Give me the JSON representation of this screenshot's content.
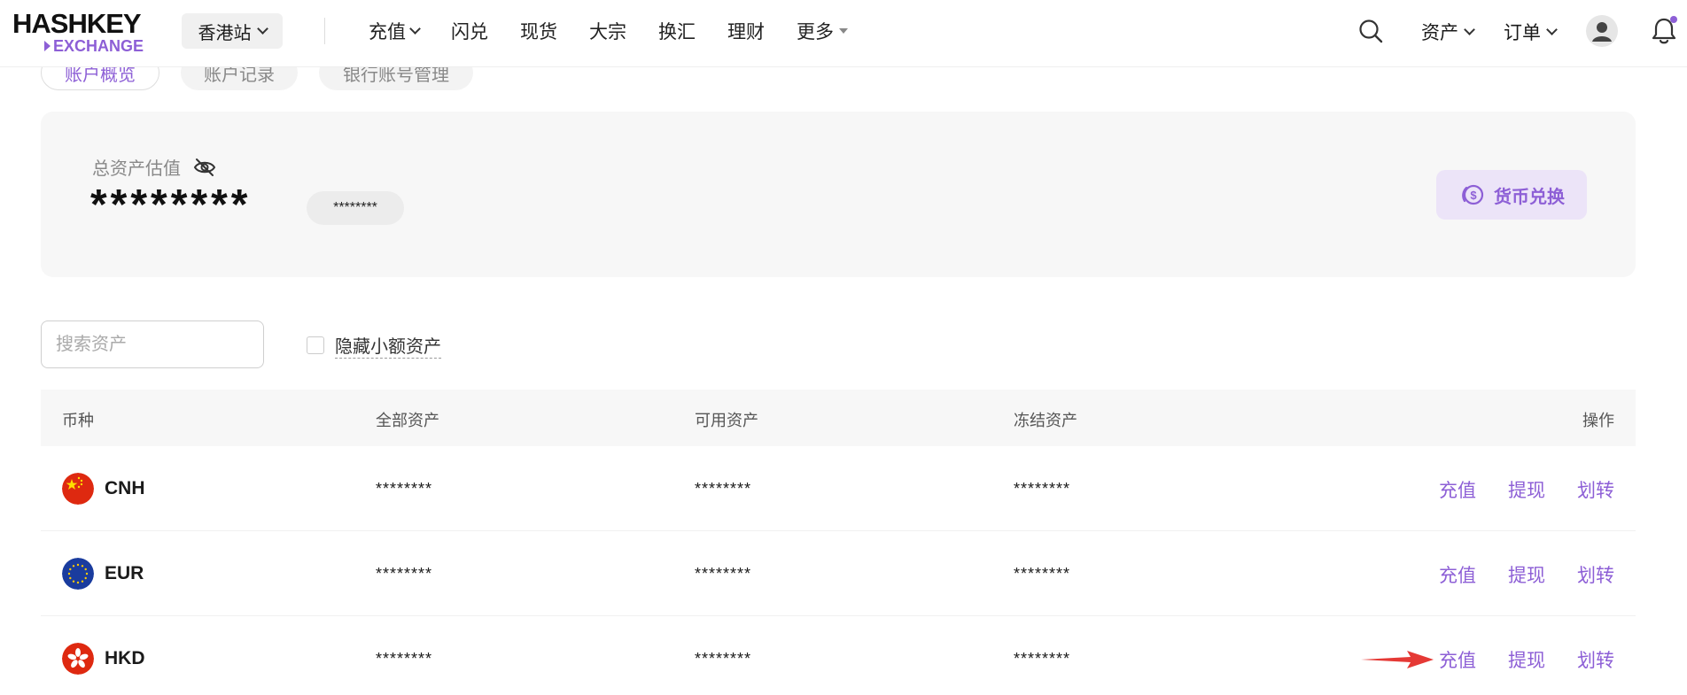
{
  "header": {
    "logo_top": "HASHKEY",
    "logo_bottom": "EXCHANGE",
    "site": "香港站",
    "nav": [
      {
        "label": "充值",
        "dropdown": "chevron"
      },
      {
        "label": "闪兑"
      },
      {
        "label": "现货"
      },
      {
        "label": "大宗"
      },
      {
        "label": "换汇"
      },
      {
        "label": "理财"
      },
      {
        "label": "更多",
        "dropdown": "caret"
      }
    ],
    "assets_label": "资产",
    "orders_label": "订单",
    "icons": [
      "search-icon",
      "avatar-icon",
      "bell-icon"
    ]
  },
  "tabs": [
    {
      "label": "账户概览",
      "active": true
    },
    {
      "label": "账户记录",
      "active": false
    },
    {
      "label": "银行账号管理",
      "active": false
    }
  ],
  "summary": {
    "label": "总资产估值",
    "value": "********",
    "sub_value": "********",
    "convert_label": "货币兑换"
  },
  "filter": {
    "search_placeholder": "搜索资产",
    "hide_small_label": "隐藏小额资产"
  },
  "table": {
    "headers": {
      "currency": "币种",
      "total": "全部资产",
      "available": "可用资产",
      "frozen": "冻结资产",
      "actions": "操作"
    },
    "rows": [
      {
        "currency": "CNH",
        "total": "********",
        "available": "********",
        "frozen": "********",
        "deposit": "充值",
        "withdraw": "提现",
        "transfer": "划转"
      },
      {
        "currency": "EUR",
        "total": "********",
        "available": "********",
        "frozen": "********",
        "deposit": "充值",
        "withdraw": "提现",
        "transfer": "划转"
      },
      {
        "currency": "HKD",
        "total": "********",
        "available": "********",
        "frozen": "********",
        "deposit": "充值",
        "withdraw": "提现",
        "transfer": "划转"
      }
    ]
  },
  "colors": {
    "accent": "#8d5fd6",
    "annotation_arrow": "#e53935"
  }
}
